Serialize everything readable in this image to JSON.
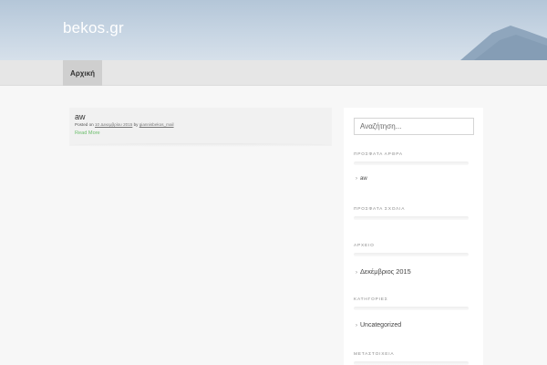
{
  "site": {
    "title": "bekos.gr"
  },
  "nav": {
    "home_label": "Αρχική"
  },
  "post": {
    "title": "aw",
    "meta_prefix": "Posted on",
    "date": "10 Δεκεμβρίου 2015",
    "by": "by",
    "author": "giannisbekos_mail",
    "read_more": "Read More"
  },
  "sidebar": {
    "search_placeholder": "Αναζήτηση...",
    "recent_posts": {
      "title": "ΠΡΟΣΦΑΤΑ ΑΡΘΡΑ",
      "items": [
        "aw"
      ]
    },
    "recent_comments": {
      "title": "ΠΡΟΣΦΑΤΑ ΣΧΟΛΙΑ"
    },
    "archives": {
      "title": "ΑΡΧΕΙΟ",
      "items": [
        "Δεκέμβριος 2015"
      ]
    },
    "categories": {
      "title": "ΚΑΤΗΓΟΡΙΕΣ",
      "items": [
        "Uncategorized"
      ]
    },
    "meta": {
      "title": "ΜΕΤΑΣΤΟΙΧΕΙΑ"
    }
  },
  "icons": {
    "list_arrow": "chevron-right-icon"
  }
}
